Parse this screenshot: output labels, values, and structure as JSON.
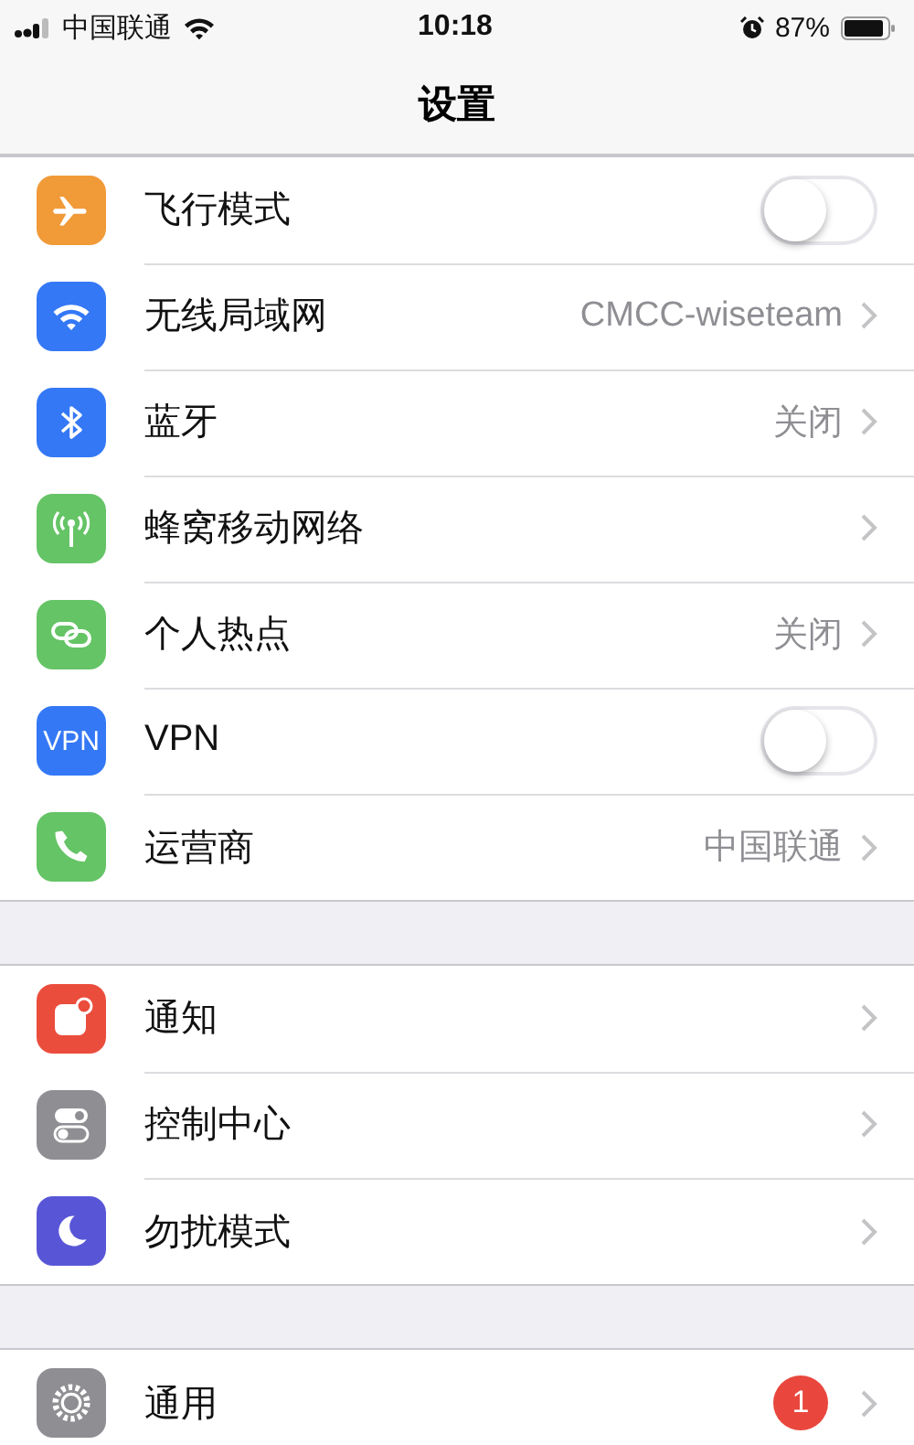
{
  "status_bar": {
    "carrier": "中国联通",
    "time": "10:18",
    "battery": "87%"
  },
  "nav": {
    "title": "设置"
  },
  "groups": [
    {
      "rows": [
        {
          "color": "#f19a38",
          "label": "飞行模式",
          "kind": "toggle",
          "on": false
        },
        {
          "color": "#3478f6",
          "label": "无线局域网",
          "kind": "link",
          "value": "CMCC-wiseteam"
        },
        {
          "color": "#3478f6",
          "label": "蓝牙",
          "kind": "link",
          "value": "关闭"
        },
        {
          "color": "#65c466",
          "label": "蜂窝移动网络",
          "kind": "link"
        },
        {
          "color": "#65c466",
          "label": "个人热点",
          "kind": "link",
          "value": "关闭"
        },
        {
          "icon_text": "VPN",
          "color": "#3478f6",
          "label": "VPN",
          "kind": "toggle",
          "on": false
        },
        {
          "color": "#65c466",
          "label": "运营商",
          "kind": "link",
          "value": "中国联通"
        }
      ]
    },
    {
      "rows": [
        {
          "color": "#eb4d3d",
          "label": "通知",
          "kind": "link"
        },
        {
          "color": "#8e8e93",
          "label": "控制中心",
          "kind": "link"
        },
        {
          "color": "#5856d6",
          "label": "勿扰模式",
          "kind": "link"
        }
      ]
    },
    {
      "rows": [
        {
          "color": "#8e8e93",
          "label": "通用",
          "kind": "link",
          "badge": "1"
        }
      ]
    }
  ]
}
